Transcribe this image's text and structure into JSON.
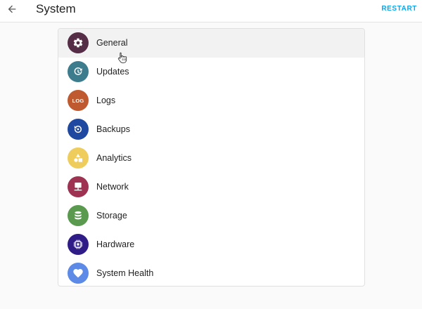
{
  "header": {
    "title": "System",
    "restart_label": "RESTART"
  },
  "menu": {
    "items": [
      {
        "label": "General",
        "icon": "gear-icon",
        "color": "#552d46",
        "active": true
      },
      {
        "label": "Updates",
        "icon": "update-icon",
        "color": "#3d7c8d"
      },
      {
        "label": "Logs",
        "icon": "log-icon",
        "icon_text": "LOG",
        "color": "#bf5a30"
      },
      {
        "label": "Backups",
        "icon": "backup-icon",
        "color": "#1f48a0"
      },
      {
        "label": "Analytics",
        "icon": "shapes-icon",
        "color": "#efcd5c"
      },
      {
        "label": "Network",
        "icon": "network-icon",
        "color": "#9d3252"
      },
      {
        "label": "Storage",
        "icon": "database-icon",
        "color": "#5a9a4f"
      },
      {
        "label": "Hardware",
        "icon": "chip-icon",
        "color": "#301c86"
      },
      {
        "label": "System Health",
        "icon": "heart-icon",
        "color": "#5d8ae6"
      }
    ]
  },
  "colors": {
    "accent": "#03a9f4",
    "background": "#fafafa"
  }
}
